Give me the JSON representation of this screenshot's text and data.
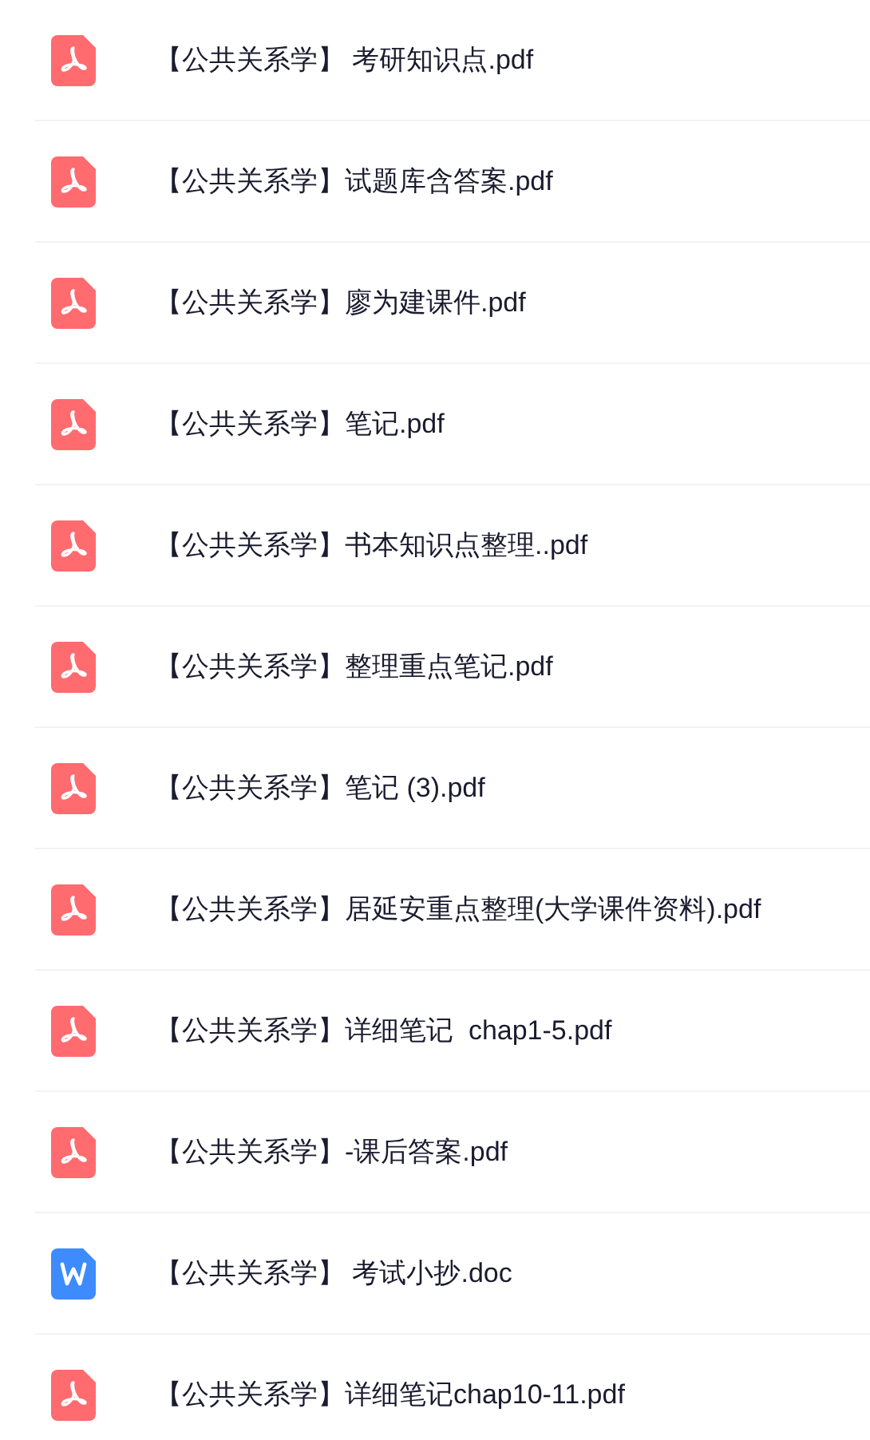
{
  "files": [
    {
      "kind": "pdf",
      "name": "【公共关系学】 考研知识点.pdf"
    },
    {
      "kind": "pdf",
      "name": "【公共关系学】试题库含答案.pdf"
    },
    {
      "kind": "pdf",
      "name": "【公共关系学】廖为建课件.pdf"
    },
    {
      "kind": "pdf",
      "name": "【公共关系学】笔记.pdf"
    },
    {
      "kind": "pdf",
      "name": "【公共关系学】书本知识点整理..pdf"
    },
    {
      "kind": "pdf",
      "name": "【公共关系学】整理重点笔记.pdf"
    },
    {
      "kind": "pdf",
      "name": "【公共关系学】笔记 (3).pdf"
    },
    {
      "kind": "pdf",
      "name": "【公共关系学】居延安重点整理(大学课件资料).pdf"
    },
    {
      "kind": "pdf",
      "name": "【公共关系学】详细笔记  chap1-5.pdf"
    },
    {
      "kind": "pdf",
      "name": "【公共关系学】-课后答案.pdf"
    },
    {
      "kind": "doc",
      "name": "【公共关系学】 考试小抄.doc"
    },
    {
      "kind": "pdf",
      "name": "【公共关系学】详细笔记chap10-11.pdf"
    }
  ]
}
